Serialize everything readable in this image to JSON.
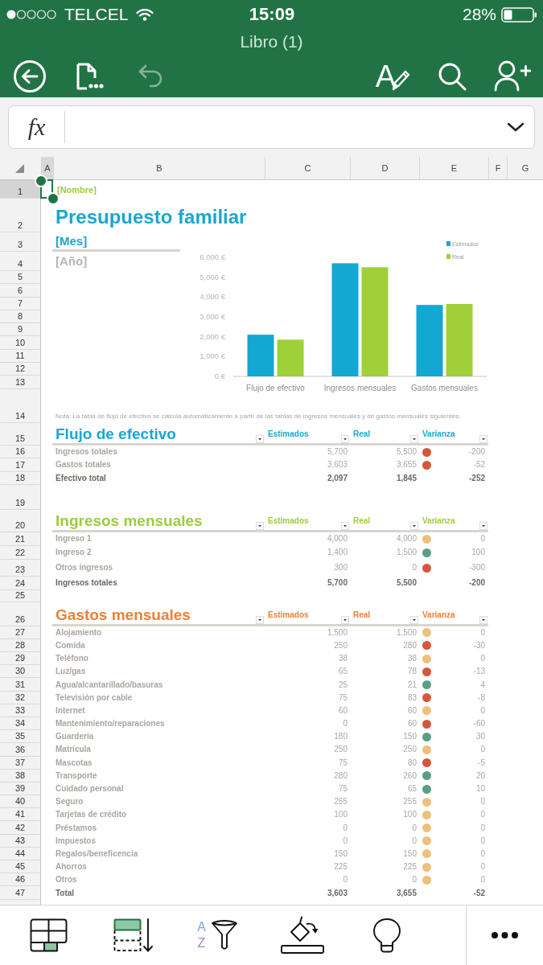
{
  "status_bar": {
    "carrier": "TELCEL",
    "time": "15:09",
    "battery": "28%"
  },
  "title_bar": {
    "title": "Libro (1)"
  },
  "toolbar": {
    "left": [
      {
        "kind": "back",
        "disabled": false
      },
      {
        "kind": "file",
        "disabled": false
      },
      {
        "kind": "undo",
        "disabled": true
      }
    ],
    "right": [
      {
        "kind": "format",
        "label": "A",
        "disabled": false
      },
      {
        "kind": "search",
        "disabled": false
      },
      {
        "kind": "share",
        "disabled": false
      }
    ]
  },
  "formula_bar": {
    "label": "fx"
  },
  "column_headers": [
    {
      "label": "A",
      "selected": true
    },
    {
      "label": "B",
      "selected": false
    },
    {
      "label": "C",
      "selected": false
    },
    {
      "label": "D",
      "selected": false
    },
    {
      "label": "E",
      "selected": false
    },
    {
      "label": "F",
      "selected": false
    },
    {
      "label": "G",
      "selected": false
    }
  ],
  "row_headers": [
    {
      "label": "1",
      "selected": true
    },
    {
      "label": "2",
      "selected": false
    },
    {
      "label": "3",
      "selected": false
    },
    {
      "label": "4",
      "selected": false
    },
    {
      "label": "5",
      "selected": false
    },
    {
      "label": "6",
      "selected": false
    },
    {
      "label": "7",
      "selected": false
    },
    {
      "label": "8",
      "selected": false
    },
    {
      "label": "9",
      "selected": false
    },
    {
      "label": "10",
      "selected": false
    },
    {
      "label": "11",
      "selected": false
    },
    {
      "label": "12",
      "selected": false
    },
    {
      "label": "13",
      "selected": false
    },
    {
      "label": "14",
      "selected": false
    },
    {
      "label": "15",
      "selected": false
    },
    {
      "label": "16",
      "selected": false
    },
    {
      "label": "17",
      "selected": false
    },
    {
      "label": "18",
      "selected": false
    },
    {
      "label": "19",
      "selected": false
    },
    {
      "label": "20",
      "selected": false
    },
    {
      "label": "21",
      "selected": false
    },
    {
      "label": "22",
      "selected": false
    },
    {
      "label": "23",
      "selected": false
    },
    {
      "label": "24",
      "selected": false
    },
    {
      "label": "25",
      "selected": false
    },
    {
      "label": "26",
      "selected": false
    },
    {
      "label": "27",
      "selected": false
    },
    {
      "label": "28",
      "selected": false
    },
    {
      "label": "29",
      "selected": false
    },
    {
      "label": "30",
      "selected": false
    },
    {
      "label": "31",
      "selected": false
    },
    {
      "label": "32",
      "selected": false
    },
    {
      "label": "33",
      "selected": false
    },
    {
      "label": "34",
      "selected": false
    },
    {
      "label": "35",
      "selected": false
    },
    {
      "label": "36",
      "selected": false
    },
    {
      "label": "37",
      "selected": false
    },
    {
      "label": "38",
      "selected": false
    },
    {
      "label": "39",
      "selected": false
    },
    {
      "label": "40",
      "selected": false
    },
    {
      "label": "41",
      "selected": false
    },
    {
      "label": "42",
      "selected": false
    },
    {
      "label": "43",
      "selected": false
    },
    {
      "label": "44",
      "selected": false
    },
    {
      "label": "45",
      "selected": false
    },
    {
      "label": "46",
      "selected": false
    },
    {
      "label": "47",
      "selected": false
    }
  ],
  "sheet": {
    "name": "[Nombre]",
    "title": "Presupuesto familiar",
    "month": "[Mes]",
    "year": "[Año]",
    "chart_data": {
      "type": "bar",
      "legend": "top-right",
      "categories": [
        "Flujo de efectivo",
        "Ingresos mensuales",
        "Gastos mensuales"
      ],
      "series": [
        {
          "name": "Estimados",
          "color": "#12a8d2",
          "values": [
            2100,
            5700,
            3600
          ]
        },
        {
          "name": "Real",
          "color": "#9fd03a",
          "values": [
            1850,
            5500,
            3650
          ]
        }
      ],
      "ylim": [
        0,
        6000
      ],
      "yticks": [
        {
          "value": 0,
          "label": "0 €"
        },
        {
          "value": 1000,
          "label": "1,000 €"
        },
        {
          "value": 2000,
          "label": "2,000 €"
        },
        {
          "value": 3000,
          "label": "3,000 €"
        },
        {
          "value": 4000,
          "label": "4,000 €"
        },
        {
          "value": 5000,
          "label": "5,000 €"
        },
        {
          "value": 6000,
          "label": "6,000 €"
        }
      ]
    },
    "note": "Nota: La tabla de flujo de efectivo se calcula automáticamente a partir de las tablas de ingresos mensuales y de gastos mensuales siguientes."
  },
  "tables": [
    {
      "title": "Flujo de efectivo",
      "color": "#1aa7d1",
      "columns": [
        "Estimados",
        "Real",
        "Varianza"
      ],
      "rows": [
        {
          "kind": "item",
          "label": "Ingresos totales",
          "estimated": "5,700",
          "real": "5,500",
          "color": "#d4573a",
          "variance": "-200"
        },
        {
          "kind": "item",
          "label": "Gastos totales",
          "estimated": "3,603",
          "real": "3,655",
          "color": "#d4573a",
          "variance": "-52"
        },
        {
          "kind": "total",
          "label": "Efectivo total",
          "estimated": "2,097",
          "real": "1,845",
          "variance": "-252"
        }
      ]
    },
    {
      "title": "Ingresos mensuales",
      "color": "#9dcd3c",
      "columns": [
        "Estimados",
        "Real",
        "Varianza"
      ],
      "rows": [
        {
          "kind": "item",
          "label": "Ingreso 1",
          "estimated": "4,000",
          "real": "4,000",
          "color": "#edc07c",
          "variance": "0"
        },
        {
          "kind": "item",
          "label": "Ingreso 2",
          "estimated": "1,400",
          "real": "1,500",
          "color": "#5b9d86",
          "variance": "100"
        },
        {
          "kind": "item",
          "label": "Otros ingresos",
          "estimated": "300",
          "real": "0",
          "color": "#d4573a",
          "variance": "-300"
        },
        {
          "kind": "total",
          "label": "Ingresos totales",
          "estimated": "5,700",
          "real": "5,500",
          "variance": "-200"
        }
      ]
    },
    {
      "title": "Gastos mensuales",
      "color": "#ef7f35",
      "columns": [
        "Estimados",
        "Real",
        "Varianza"
      ],
      "rows": [
        {
          "kind": "item",
          "label": "Alojamiento",
          "estimated": "1,500",
          "real": "1,500",
          "color": "#edc07c",
          "variance": "0"
        },
        {
          "kind": "item",
          "label": "Comida",
          "estimated": "250",
          "real": "280",
          "color": "#d4573a",
          "variance": "-30"
        },
        {
          "kind": "item",
          "label": "Teléfono",
          "estimated": "38",
          "real": "38",
          "color": "#edc07c",
          "variance": "0"
        },
        {
          "kind": "item",
          "label": "Luz/gas",
          "estimated": "65",
          "real": "78",
          "color": "#d4573a",
          "variance": "-13"
        },
        {
          "kind": "item",
          "label": "Agua/alcantarillado/basuras",
          "estimated": "25",
          "real": "21",
          "color": "#5b9d86",
          "variance": "4"
        },
        {
          "kind": "item",
          "label": "Televisión por cable",
          "estimated": "75",
          "real": "83",
          "color": "#d4573a",
          "variance": "-8"
        },
        {
          "kind": "item",
          "label": "Internet",
          "estimated": "60",
          "real": "60",
          "color": "#edc07c",
          "variance": "0"
        },
        {
          "kind": "item",
          "label": "Mantenimiento/reparaciones",
          "estimated": "0",
          "real": "60",
          "color": "#d4573a",
          "variance": "-60"
        },
        {
          "kind": "item",
          "label": "Guardería",
          "estimated": "180",
          "real": "150",
          "color": "#5b9d86",
          "variance": "30"
        },
        {
          "kind": "item",
          "label": "Matrícula",
          "estimated": "250",
          "real": "250",
          "color": "#edc07c",
          "variance": "0"
        },
        {
          "kind": "item",
          "label": "Mascotas",
          "estimated": "75",
          "real": "80",
          "color": "#d4573a",
          "variance": "-5"
        },
        {
          "kind": "item",
          "label": "Transporte",
          "estimated": "280",
          "real": "260",
          "color": "#5b9d86",
          "variance": "20"
        },
        {
          "kind": "item",
          "label": "Cuidado personal",
          "estimated": "75",
          "real": "65",
          "color": "#5b9d86",
          "variance": "10"
        },
        {
          "kind": "item",
          "label": "Seguro",
          "estimated": "255",
          "real": "255",
          "color": "#edc07c",
          "variance": "0"
        },
        {
          "kind": "item",
          "label": "Tarjetas de crédito",
          "estimated": "100",
          "real": "100",
          "color": "#edc07c",
          "variance": "0"
        },
        {
          "kind": "item",
          "label": "Préstamos",
          "estimated": "0",
          "real": "0",
          "color": "#edc07c",
          "variance": "0"
        },
        {
          "kind": "item",
          "label": "Impuestos",
          "estimated": "0",
          "real": "0",
          "color": "#edc07c",
          "variance": "0"
        },
        {
          "kind": "item",
          "label": "Regalos/beneficencia",
          "estimated": "150",
          "real": "150",
          "color": "#edc07c",
          "variance": "0"
        },
        {
          "kind": "item",
          "label": "Ahorros",
          "estimated": "225",
          "real": "225",
          "color": "#edc07c",
          "variance": "0"
        },
        {
          "kind": "item",
          "label": "Otros",
          "estimated": "0",
          "real": "0",
          "color": "#edc07c",
          "variance": "0"
        },
        {
          "kind": "total",
          "label": "Total",
          "estimated": "3,603",
          "real": "3,655",
          "variance": "-52"
        }
      ]
    }
  ],
  "bottom_toolbar": [
    {
      "kind": "table"
    },
    {
      "kind": "insert"
    },
    {
      "kind": "sort",
      "labels": [
        "A",
        "Z"
      ]
    },
    {
      "kind": "fill"
    },
    {
      "kind": "ideas"
    },
    {
      "kind": "more"
    }
  ]
}
